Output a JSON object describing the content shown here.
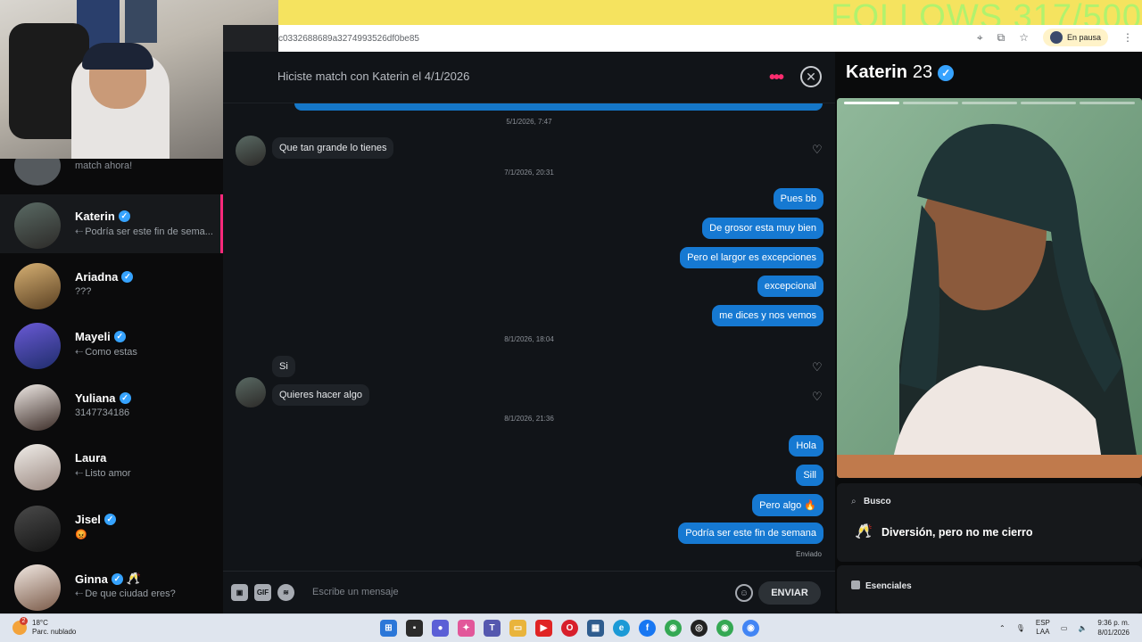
{
  "overlay": {
    "follows_text": "FOLLOWS 317/500"
  },
  "browser": {
    "url": "c0332688689a3274993526df0be85",
    "profile_status": "En pausa",
    "icons": [
      "location-icon",
      "cast-icon",
      "star-icon",
      "kebab-menu-icon"
    ]
  },
  "sidebar": {
    "match_prompt": "Con actividad reciente, ¡haz match ahora!",
    "conversations": [
      {
        "name": "Katerin",
        "preview": "Podría ser este fin de sema...",
        "replied": true,
        "active": true
      },
      {
        "name": "Ariadna",
        "preview": "???",
        "replied": false
      },
      {
        "name": "Mayeli",
        "preview": "Como estas",
        "replied": true
      },
      {
        "name": "Yuliana",
        "preview": "3147734186",
        "replied": false
      },
      {
        "name": "Laura",
        "preview": "Listo amor",
        "replied": true,
        "verified": false
      },
      {
        "name": "Jisel",
        "preview": "😡",
        "replied": false
      },
      {
        "name": "Ginna",
        "preview": "De que ciudad eres?",
        "replied": true,
        "badge": "🥂"
      }
    ]
  },
  "chat": {
    "header": "Hiciste match con Katerin el 4/1/2026",
    "timestamps": [
      "5/1/2026, 7:47",
      "7/1/2026, 20:31",
      "8/1/2026, 18:04",
      "8/1/2026, 21:36"
    ],
    "messages": [
      {
        "dir": "in",
        "text": "Que tan grande lo tienes"
      },
      {
        "dir": "out",
        "text": "Pues bb"
      },
      {
        "dir": "out",
        "text": "De grosor esta muy bien"
      },
      {
        "dir": "out",
        "text": "Pero el largor es excepciones"
      },
      {
        "dir": "out",
        "text": "excepcional"
      },
      {
        "dir": "out",
        "text": "me dices y nos vemos"
      },
      {
        "dir": "in",
        "text": "Si"
      },
      {
        "dir": "in",
        "text": "Quieres  hacer algo"
      },
      {
        "dir": "out",
        "text": "Hola"
      },
      {
        "dir": "out",
        "text": "Sill"
      },
      {
        "dir": "out",
        "text": "Pero algo 🔥"
      },
      {
        "dir": "out",
        "text": "Podría ser este fin de semana"
      }
    ],
    "sent_status": "Enviado",
    "composer": {
      "placeholder": "Escribe un mensaje",
      "send_label": "ENVIAR",
      "gif_label": "GIF"
    }
  },
  "profile": {
    "name": "Katerin",
    "age": "23",
    "photo_count": 6,
    "photo_index": 1,
    "busco_label": "Busco",
    "busco_value": "Diversión, pero no me cierro",
    "esenciales_label": "Esenciales"
  },
  "taskbar": {
    "weather_temp": "18°C",
    "weather_desc": "Parc. nublado",
    "weather_badge": "2",
    "lang_1": "ESP",
    "lang_2": "LAA",
    "time": "9:36 p. m.",
    "date": "8/01/2026"
  },
  "colors": {
    "accent": "#fd297b",
    "out_bubble": "#1679d2",
    "verified": "#36a3ff"
  }
}
